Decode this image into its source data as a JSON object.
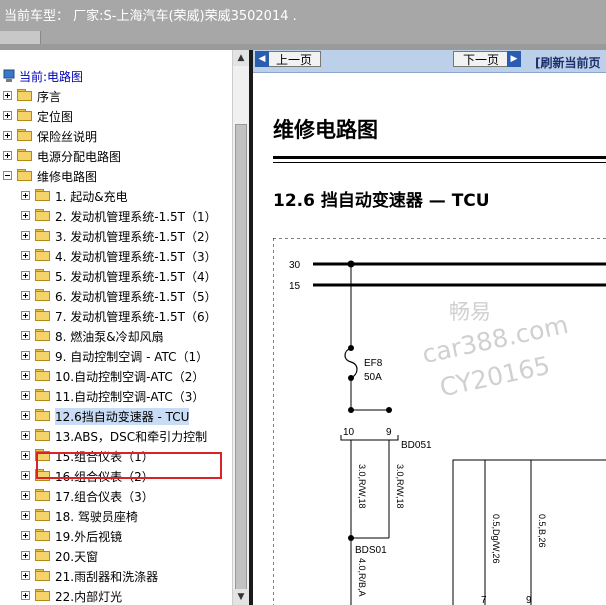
{
  "header": {
    "vehicle_title": "当前车型：  厂家:S-上海汽车(荣威)荣威3502014    ."
  },
  "tree": {
    "root_label": "当前:电路图",
    "top_items": [
      "序言",
      "定位图",
      "保险丝说明",
      "电源分配电路图",
      "维修电路图"
    ],
    "sub_items": [
      "1. 起动&充电",
      "2. 发动机管理系统-1.5T（1）",
      "3. 发动机管理系统-1.5T（2）",
      "4. 发动机管理系统-1.5T（3）",
      "5. 发动机管理系统-1.5T（4）",
      "6. 发动机管理系统-1.5T（5）",
      "7. 发动机管理系统-1.5T（6）",
      "8. 燃油泵&冷却风扇",
      "9. 自动控制空调 - ATC（1）",
      "10.自动控制空调-ATC（2）",
      "11.自动控制空调-ATC（3）",
      "12.6挡自动变速器 - TCU",
      "13.ABS，DSC和牵引力控制",
      "15.组合仪表（1）",
      "16.组合仪表（2）",
      "17.组合仪表（3）",
      "18. 驾驶员座椅",
      "19.外后视镜",
      "20.天窗",
      "21.雨刮器和洗涤器",
      "22.内部灯光"
    ],
    "selected_index": 11
  },
  "viewer": {
    "prev_label": "上一页",
    "next_label": "下一页",
    "refresh_label": "[刷新当前页",
    "page_title": "维修电路图",
    "section_title": "12.6 挡自动变速器 — TCU"
  },
  "diagram": {
    "rail_30": "30",
    "rail_15": "15",
    "fuse_name": "EF8",
    "fuse_rating": "50A",
    "pin_10": "10",
    "pin_9": "9",
    "connector_bd051": "BD051",
    "wire_1": "3.0,R/W,18",
    "wire_2": "3.0,R/W,18",
    "splice_bds01": "BDS01",
    "wire_3": "4.0,R/B,A",
    "wire_4": "0.5,Dg/W,26",
    "wire_5": "0.5,B,26",
    "pin_7": "7",
    "pin_9b": "9"
  },
  "watermark": {
    "line1": "畅易",
    "line2": "car388.com",
    "line3": "CY20165"
  },
  "colors": {
    "highlight_box": "#d8232a",
    "nav_bar": "#bcd0ea",
    "selected_item": "#c9dcf5"
  }
}
